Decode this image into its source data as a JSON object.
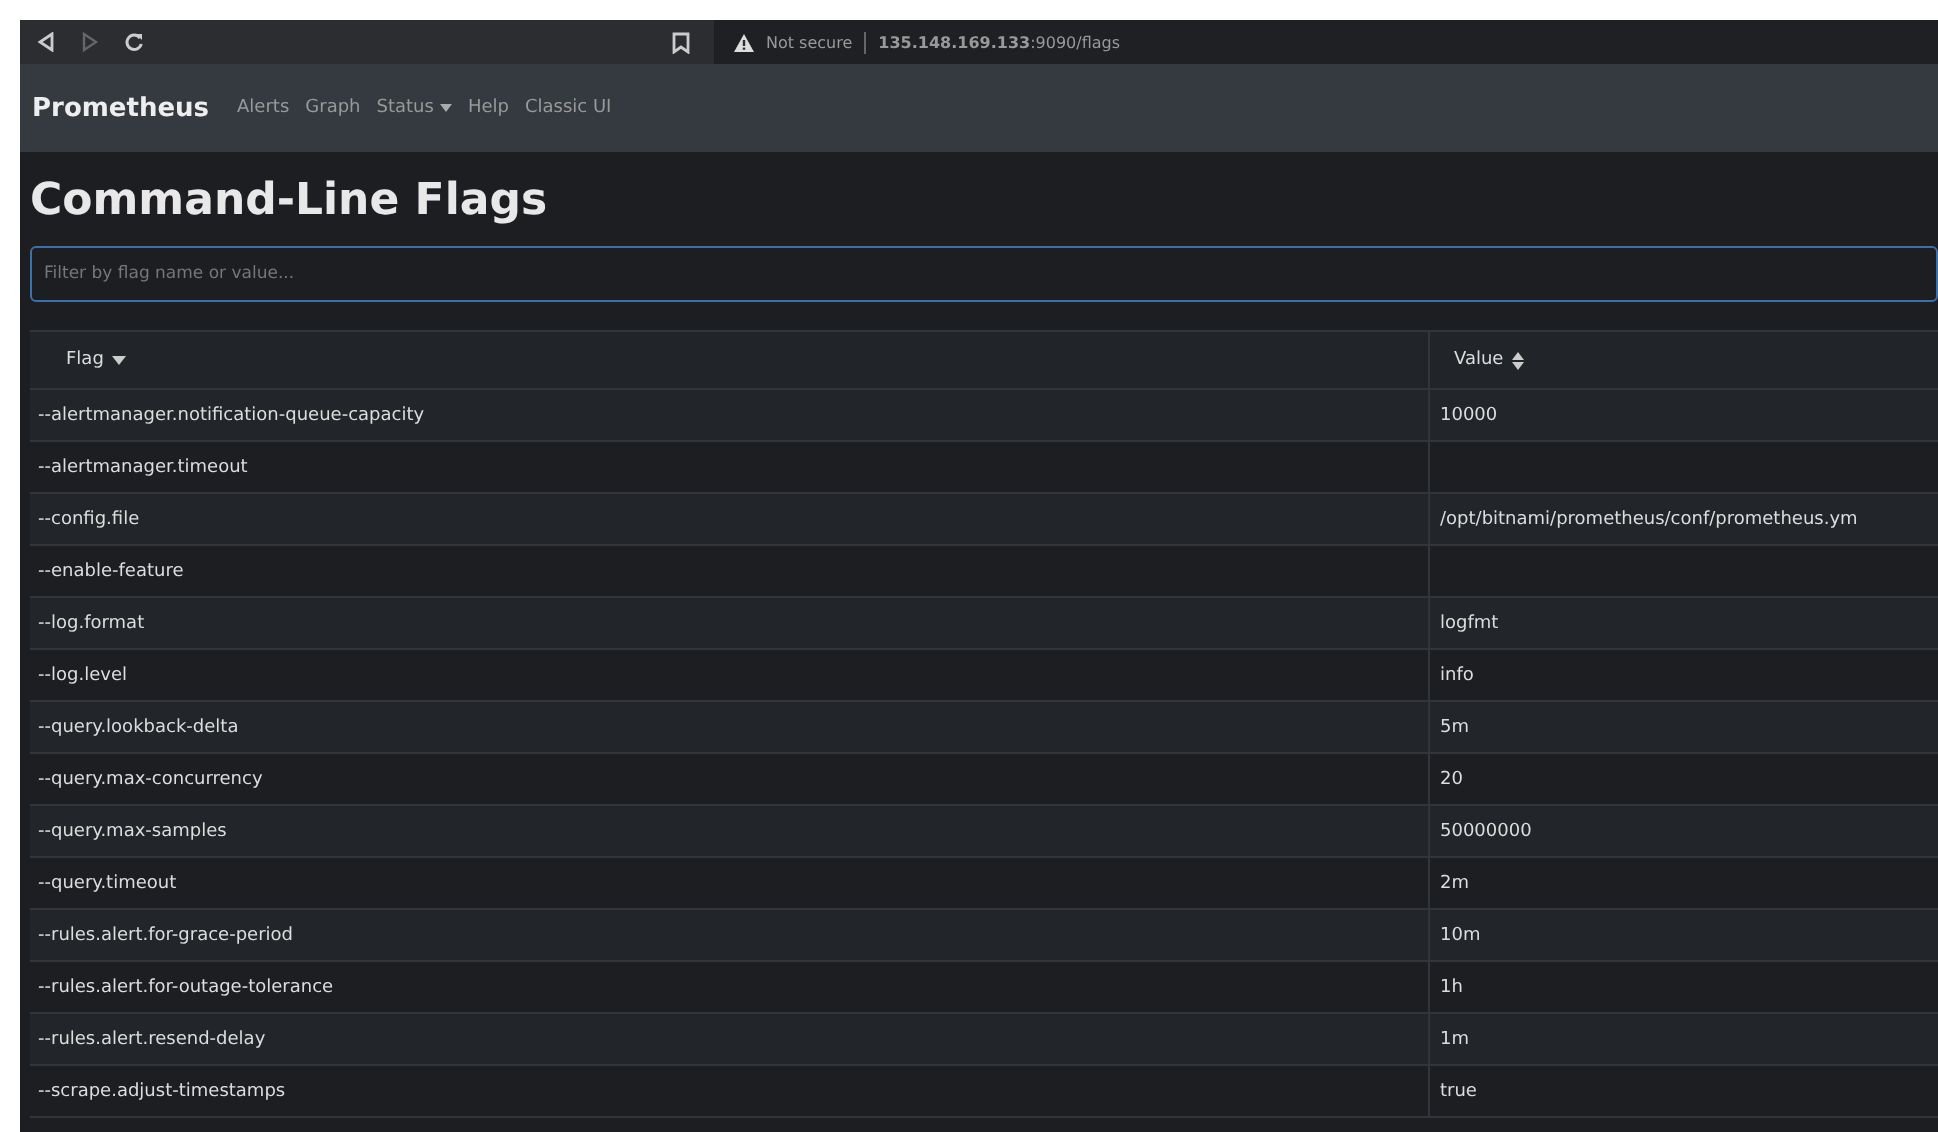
{
  "browser": {
    "security_label": "Not secure",
    "url": "**135.148.169.133**:9090/flags"
  },
  "navbar": {
    "brand": "Prometheus",
    "items": [
      {
        "label": "Alerts",
        "dropdown": false
      },
      {
        "label": "Graph",
        "dropdown": false
      },
      {
        "label": "Status",
        "dropdown": true
      },
      {
        "label": "Help",
        "dropdown": false
      },
      {
        "label": "Classic UI",
        "dropdown": false
      }
    ]
  },
  "page_title": "Command-Line Flags",
  "search": {
    "placeholder": "Filter by flag name or value..."
  },
  "table": {
    "columns": [
      {
        "label": "Flag",
        "sorted": true
      },
      {
        "label": "Value",
        "sorted": false
      }
    ],
    "rows": [
      {
        "flag": "--alertmanager.notification-queue-capacity",
        "value": "10000"
      },
      {
        "flag": "--alertmanager.timeout"
      },
      {
        "flag": "--config.file",
        "value": "/opt/bitnami/prometheus/conf/prometheus.ym"
      },
      {
        "flag": "--enable-feature"
      },
      {
        "flag": "--log.format",
        "value": "logfmt"
      },
      {
        "flag": "--log.level",
        "value": "info"
      },
      {
        "flag": "--query.lookback-delta",
        "value": "5m"
      },
      {
        "flag": "--query.max-concurrency",
        "value": "20"
      },
      {
        "flag": "--query.max-samples",
        "value": "50000000"
      },
      {
        "flag": "--query.timeout",
        "value": "2m"
      },
      {
        "flag": "--rules.alert.for-grace-period",
        "value": "10m"
      },
      {
        "flag": "--rules.alert.for-outage-tolerance",
        "value": "1h"
      },
      {
        "flag": "--rules.alert.resend-delay",
        "value": "1m"
      },
      {
        "flag": "--scrape.adjust-timestamps",
        "value": "true"
      }
    ]
  }
}
